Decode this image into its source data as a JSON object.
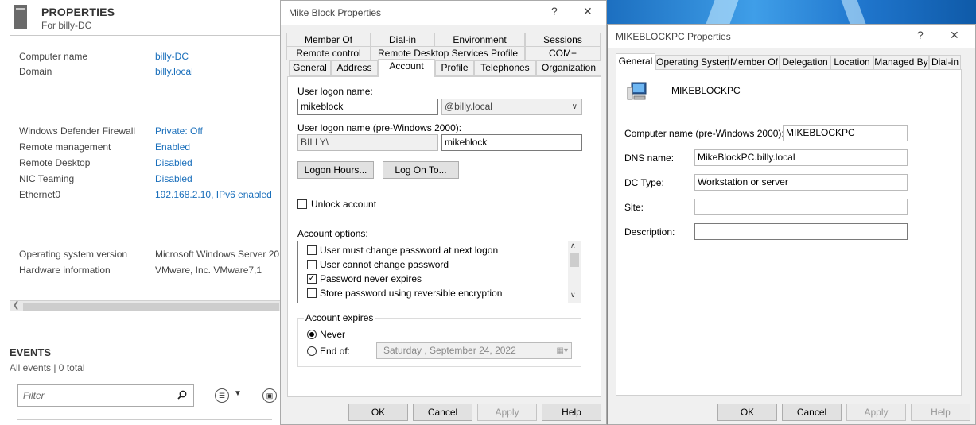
{
  "server_manager": {
    "title": "PROPERTIES",
    "subtitle": "For billy-DC",
    "properties": [
      {
        "label": "Computer name",
        "value": "billy-DC",
        "link": true
      },
      {
        "label": "Domain",
        "value": "billy.local",
        "link": true
      },
      {
        "label": "Windows Defender Firewall",
        "value": "Private: Off",
        "link": true
      },
      {
        "label": "Remote management",
        "value": "Enabled",
        "link": true
      },
      {
        "label": "Remote Desktop",
        "value": "Disabled",
        "link": true
      },
      {
        "label": "NIC Teaming",
        "value": "Disabled",
        "link": true
      },
      {
        "label": "Ethernet0",
        "value": "192.168.2.10, IPv6 enabled",
        "link": true
      },
      {
        "label": "Operating system version",
        "value": "Microsoft Windows Server 20",
        "link": false
      },
      {
        "label": "Hardware information",
        "value": "VMware, Inc. VMware7,1",
        "link": false
      }
    ],
    "events_title": "EVENTS",
    "events_subtitle": "All events | 0 total",
    "filter_placeholder": "Filter"
  },
  "user_dialog": {
    "title": "Mike Block Properties",
    "help_glyph": "?",
    "close_glyph": "✕",
    "tabs_row1": [
      "Member Of",
      "Dial-in",
      "Environment",
      "Sessions"
    ],
    "tabs_row2": [
      "Remote control",
      "Remote Desktop Services Profile",
      "COM+"
    ],
    "tabs_row3": [
      "General",
      "Address",
      "Account",
      "Profile",
      "Telephones",
      "Organization"
    ],
    "active_tab": "Account",
    "logon_name_label": "User logon name:",
    "logon_name": "mikeblock",
    "upn_suffix": "@billy.local",
    "pre2000_label": "User logon name (pre-Windows 2000):",
    "pre2000_domain": "BILLY\\",
    "pre2000_name": "mikeblock",
    "logon_hours_button": "Logon Hours...",
    "log_on_to_button": "Log On To...",
    "unlock_label": "Unlock account",
    "account_options_label": "Account options:",
    "account_options": [
      {
        "label": "User must change password at next logon",
        "checked": false
      },
      {
        "label": "User cannot change password",
        "checked": false
      },
      {
        "label": "Password never expires",
        "checked": true
      },
      {
        "label": "Store password using reversible encryption",
        "checked": false
      }
    ],
    "expires_group": "Account expires",
    "never_label": "Never",
    "endof_label": "End of:",
    "expire_date": "Saturday   , September 24, 2022",
    "buttons": {
      "ok": "OK",
      "cancel": "Cancel",
      "apply": "Apply",
      "help": "Help"
    }
  },
  "computer_dialog": {
    "title": "MIKEBLOCKPC Properties",
    "help_glyph": "?",
    "close_glyph": "✕",
    "tabs": [
      "General",
      "Operating System",
      "Member Of",
      "Delegation",
      "Location",
      "Managed By",
      "Dial-in"
    ],
    "active_tab": "General",
    "computer_name": "MIKEBLOCKPC",
    "fields": [
      {
        "label": "Computer name (pre-Windows 2000):",
        "value": "MIKEBLOCKPC"
      },
      {
        "label": "DNS name:",
        "value": "MikeBlockPC.billy.local"
      },
      {
        "label": "DC Type:",
        "value": "Workstation or server"
      },
      {
        "label": "Site:",
        "value": ""
      },
      {
        "label": "Description:",
        "value": ""
      }
    ],
    "buttons": {
      "ok": "OK",
      "cancel": "Cancel",
      "apply": "Apply",
      "help": "Help"
    }
  },
  "colors": {
    "link": "#1a6fbb",
    "dialog_bg": "#f0f0f0"
  }
}
